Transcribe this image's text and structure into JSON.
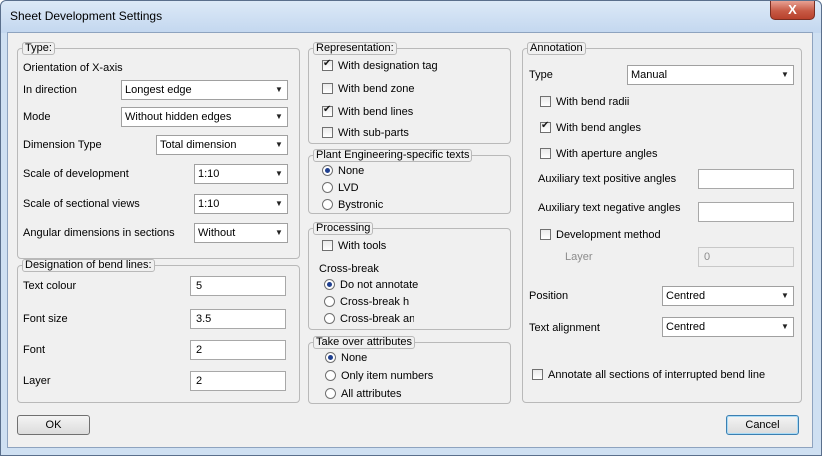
{
  "window": {
    "title": "Sheet Development Settings",
    "close_label": "X"
  },
  "type": {
    "legend": "Type:",
    "orientation_label": "Orientation of X-axis",
    "in_direction_label": "In direction",
    "in_direction_value": "Longest edge",
    "mode_label": "Mode",
    "mode_value": "Without hidden edges",
    "dimension_type_label": "Dimension Type",
    "dimension_type_value": "Total dimension",
    "scale_dev_label": "Scale of development",
    "scale_dev_value": "1:10",
    "scale_sec_label": "Scale of sectional views",
    "scale_sec_value": "1:10",
    "angular_label": "Angular dimensions in sections",
    "angular_value": "Without"
  },
  "designation": {
    "legend": "Designation of bend lines:",
    "text_colour_label": "Text colour",
    "text_colour_value": "5",
    "font_size_label": "Font size",
    "font_size_value": "3.5",
    "font_label": "Font",
    "font_value": "2",
    "layer_label": "Layer",
    "layer_value": "2"
  },
  "representation": {
    "legend": "Representation:",
    "with_designation_tag": "With designation tag",
    "with_bend_zone": "With bend zone",
    "with_bend_lines": "With bend lines",
    "with_sub_parts": "With sub-parts"
  },
  "plant": {
    "legend": "Plant Engineering-specific texts",
    "none": "None",
    "lvd": "LVD",
    "bystronic": "Bystronic"
  },
  "processing": {
    "legend": "Processing",
    "with_tools": "With tools",
    "cross_break_label": "Cross-break",
    "do_not_annotate": "Do not annotate",
    "cross_break_h": "Cross-break h",
    "cross_break_an": "Cross-break an"
  },
  "take_over": {
    "legend": "Take over attributes",
    "none": "None",
    "only_item_numbers": "Only item numbers",
    "all_attributes": "All attributes"
  },
  "annotation": {
    "legend": "Annotation",
    "type_label": "Type",
    "type_value": "Manual",
    "with_bend_radii": "With bend radii",
    "with_bend_angles": "With bend angles",
    "with_aperture_angles": "With aperture angles",
    "aux_positive_label": "Auxiliary text positive angles",
    "aux_positive_value": "",
    "aux_negative_label": "Auxiliary text negative angles",
    "aux_negative_value": "",
    "development_method": "Development method",
    "layer_label": "Layer",
    "layer_value": "0",
    "position_label": "Position",
    "position_value": "Centred",
    "text_alignment_label": "Text alignment",
    "text_alignment_value": "Centred",
    "annotate_all": "Annotate all sections of interrupted bend line"
  },
  "buttons": {
    "ok": "OK",
    "cancel": "Cancel"
  }
}
